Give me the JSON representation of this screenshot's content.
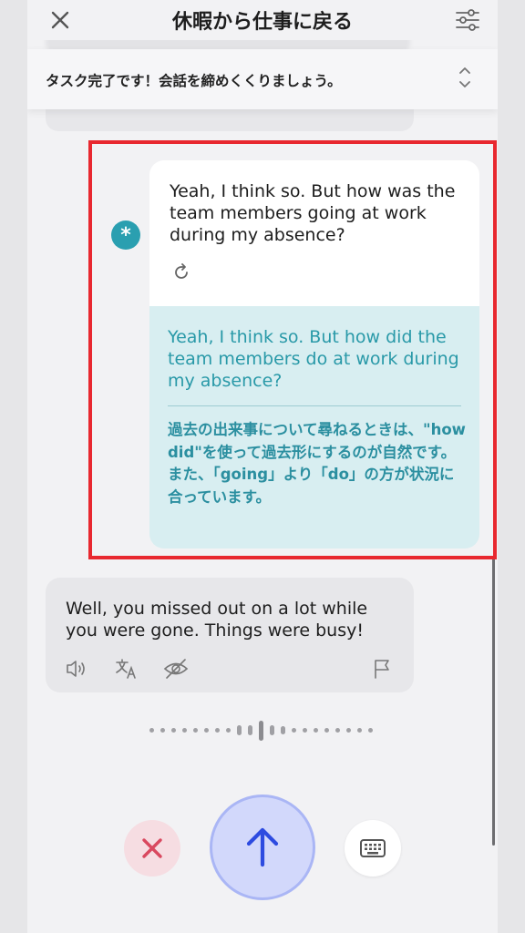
{
  "header": {
    "title": "休暇から仕事に戻る",
    "close_icon": "close-icon",
    "settings_icon": "sliders-icon"
  },
  "banner": {
    "text": "タスク完了です！会話を締めくくりましょう。",
    "icon": "chevron-up-down-icon"
  },
  "user_message": {
    "avatar_glyph": "*",
    "text": "Yeah, I think so. But how was the team members going at work during my absence?",
    "retry_icon": "refresh-icon"
  },
  "correction": {
    "corrected_text": "Yeah, I think so. But how did the team members do at work during my absence?",
    "explanation": "過去の出来事について尋ねるときは、\"how did\"を使って過去形にするのが自然です。また、「going」より「do」の方が状況に合っています。"
  },
  "bot_message": {
    "text": "Well, you missed out on a lot while you were gone. Things were busy!",
    "actions": [
      "speaker-icon",
      "translate-icon",
      "eye-off-icon",
      "flag-icon"
    ]
  },
  "controls": {
    "cancel_icon": "close-icon",
    "send_icon": "arrow-up-icon",
    "keyboard_icon": "keyboard-icon"
  },
  "colors": {
    "accent_teal": "#2a9fb0",
    "highlight_red": "#e8282f",
    "send_blue": "#2d4be0",
    "cancel_red": "#d9485f"
  }
}
